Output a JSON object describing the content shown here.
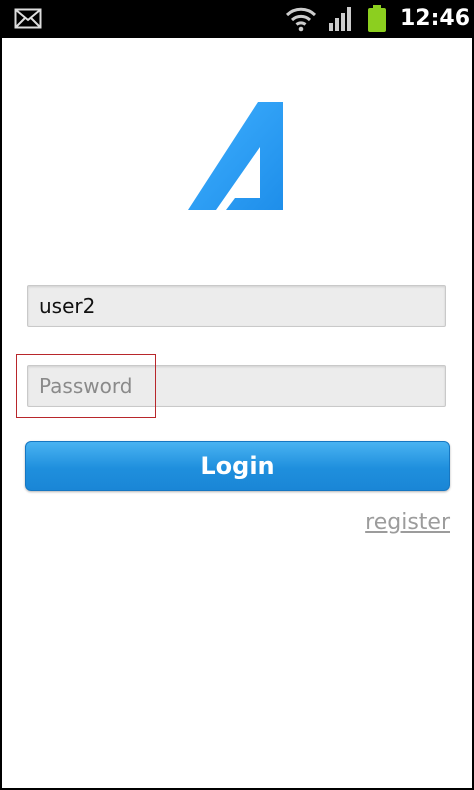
{
  "status_bar": {
    "time": "12:46",
    "icons": [
      "mail-icon",
      "wifi-icon",
      "signal-icon",
      "battery-icon"
    ]
  },
  "app": {
    "logo_icon": "app-logo-icon",
    "brand_color": "#2f9ff5"
  },
  "form": {
    "username_value": "user2",
    "password_placeholder": "Password",
    "login_label": "Login",
    "register_label": "register"
  },
  "colors": {
    "button": "#2494e3",
    "highlight": "#b8272b",
    "link": "#9c9c9c"
  }
}
